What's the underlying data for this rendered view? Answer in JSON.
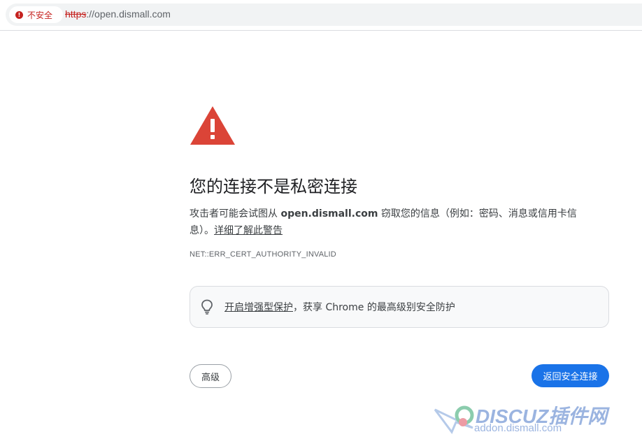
{
  "address_bar": {
    "security_label": "不安全",
    "url_scheme": "https",
    "url_rest": "://open.dismall.com"
  },
  "interstitial": {
    "heading": "您的连接不是私密连接",
    "explain_prefix": "攻击者可能会试图从 ",
    "host": "open.dismall.com",
    "explain_suffix": " 窃取您的信息（例如：密码、消息或信用卡信息）。",
    "learn_more": "详细了解此警告",
    "error_code": "NET::ERR_CERT_AUTHORITY_INVALID"
  },
  "promo": {
    "link_text": "开启增强型保护",
    "rest_text": "，获享 Chrome 的最高级别安全防护",
    "icon": "lightbulb-icon"
  },
  "buttons": {
    "advanced": "高级",
    "back_to_safety": "返回安全连接"
  },
  "watermark": {
    "brand": "DISCUZ插件网",
    "domain": "addon.dismall.com"
  },
  "colors": {
    "danger": "#c5221f",
    "primary": "#1a73e8",
    "warning_triangle": "#db4437"
  }
}
